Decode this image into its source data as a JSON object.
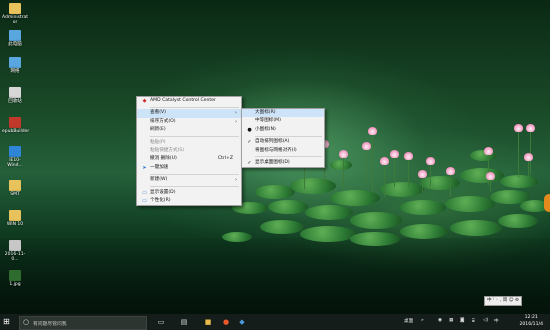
{
  "desktop_icons": [
    {
      "name": "administrator-folder-icon",
      "label": "Administrat\nor",
      "color": "#e8c25b"
    },
    {
      "name": "computer-icon",
      "label": "此电脑",
      "color": "#5aa7e0"
    },
    {
      "name": "network-icon",
      "label": "网络",
      "color": "#5aa7e0"
    },
    {
      "name": "recycle-bin-icon",
      "label": "回收站",
      "color": "#d7d7d7"
    },
    {
      "name": "epubbuilder-icon",
      "label": "epubBuilder",
      "color": "#c0392b"
    },
    {
      "name": "ie-icon",
      "label": "IE10-Wind...",
      "color": "#2f86d6"
    },
    {
      "name": "smt-folder-icon",
      "label": "SMT",
      "color": "#e8c25b"
    },
    {
      "name": "win10-folder-icon",
      "label": "WIN 10",
      "color": "#e8c25b"
    },
    {
      "name": "file-icon",
      "label": "2016-11-0...",
      "color": "#c7c7c7"
    },
    {
      "name": "image-file-icon",
      "label": "1.jpg",
      "color": "#2e6b2e"
    }
  ],
  "context_menu": {
    "items": [
      {
        "type": "item",
        "label": "AMD Catalyst Control Center",
        "icon": "amd-red-icon"
      },
      {
        "type": "sep"
      },
      {
        "type": "item",
        "label": "查看(V)",
        "submenu": true,
        "highlight": true
      },
      {
        "type": "item",
        "label": "排序方式(O)",
        "submenu": true
      },
      {
        "type": "item",
        "label": "刷新(E)"
      },
      {
        "type": "sep"
      },
      {
        "type": "item",
        "label": "粘贴(P)",
        "disabled": true
      },
      {
        "type": "item",
        "label": "粘贴快捷方式(S)",
        "disabled": true
      },
      {
        "type": "item",
        "label": "撤消 删除(U)",
        "shortcut": "Ctrl+Z"
      },
      {
        "type": "item",
        "label": "一键加速",
        "icon": "speed-icon"
      },
      {
        "type": "sep"
      },
      {
        "type": "item",
        "label": "新建(W)",
        "submenu": true
      },
      {
        "type": "sep"
      },
      {
        "type": "item",
        "label": "显示设置(D)",
        "icon": "display-icon"
      },
      {
        "type": "item",
        "label": "个性化(R)",
        "icon": "personalize-icon"
      }
    ]
  },
  "view_submenu": {
    "items": [
      {
        "type": "item",
        "label": "大图标(R)",
        "highlight": true
      },
      {
        "type": "item",
        "label": "中等图标(M)"
      },
      {
        "type": "item",
        "label": "小图标(N)",
        "mark": "dot"
      },
      {
        "type": "sep"
      },
      {
        "type": "item",
        "label": "自动排列图标(A)",
        "mark": "check"
      },
      {
        "type": "item",
        "label": "将图标与网格对齐(I)"
      },
      {
        "type": "sep"
      },
      {
        "type": "item",
        "label": "显示桌面图标(D)",
        "mark": "check"
      }
    ]
  },
  "taskbar": {
    "start_icon": "⊞",
    "search_placeholder": "有问题尽管问我",
    "clock_time": "12:21",
    "clock_date": "2016/11/4",
    "desktop_label": "桌面",
    "ime_text": "中 ⁾ ◦ , 简 ☺ ⚙"
  }
}
